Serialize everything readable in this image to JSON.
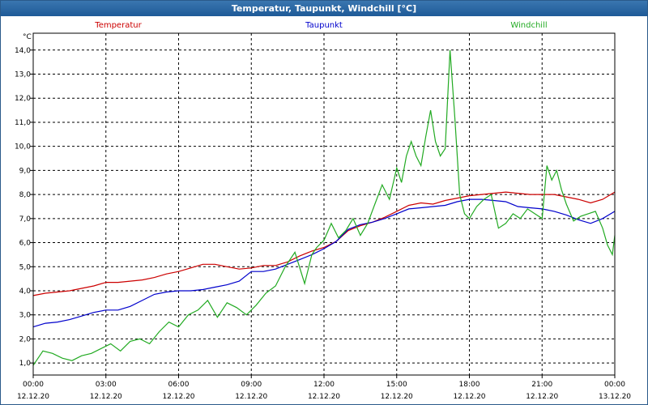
{
  "window": {
    "title": "Temperatur, Taupunkt, Windchill [°C]"
  },
  "colors": {
    "temperatur": "#cc0000",
    "taupunkt": "#0000cc",
    "windchill": "#22aa22",
    "grid": "#000000"
  },
  "chart_data": {
    "type": "line",
    "title": "Temperatur, Taupunkt, Windchill [°C]",
    "ylabel": "°C",
    "ylim": [
      0.5,
      14.7
    ],
    "yticks": [
      "1,0",
      "2,0",
      "3,0",
      "4,0",
      "5,0",
      "6,0",
      "7,0",
      "8,0",
      "9,0",
      "10,0",
      "11,0",
      "12,0",
      "13,0",
      "14,0"
    ],
    "ytick_values": [
      1,
      2,
      3,
      4,
      5,
      6,
      7,
      8,
      9,
      10,
      11,
      12,
      13,
      14
    ],
    "xlim": [
      0,
      24
    ],
    "xticks": [
      {
        "x": 0,
        "time": "00:00",
        "date": "12.12.20"
      },
      {
        "x": 3,
        "time": "03:00",
        "date": "12.12.20"
      },
      {
        "x": 6,
        "time": "06:00",
        "date": "12.12.20"
      },
      {
        "x": 9,
        "time": "09:00",
        "date": "12.12.20"
      },
      {
        "x": 12,
        "time": "12:00",
        "date": "12.12.20"
      },
      {
        "x": 15,
        "time": "15:00",
        "date": "12.12.20"
      },
      {
        "x": 18,
        "time": "18:00",
        "date": "12.12.20"
      },
      {
        "x": 21,
        "time": "21:00",
        "date": "12.12.20"
      },
      {
        "x": 24,
        "time": "00:00",
        "date": "13.12.20"
      }
    ],
    "grid": true,
    "legend_placement": "top",
    "series": [
      {
        "name": "Temperatur",
        "x": [
          0,
          0.5,
          1,
          1.5,
          2,
          2.5,
          3,
          3.5,
          4,
          4.5,
          5,
          5.5,
          6,
          6.5,
          7,
          7.5,
          8,
          8.5,
          9,
          9.5,
          10,
          10.5,
          11,
          11.5,
          12,
          12.5,
          13,
          13.5,
          14,
          14.5,
          15,
          15.5,
          16,
          16.5,
          17,
          17.5,
          18,
          18.5,
          19,
          19.5,
          20,
          20.5,
          21,
          21.5,
          22,
          22.5,
          23,
          23.5,
          24
        ],
        "values": [
          3.8,
          3.9,
          3.95,
          4.0,
          4.1,
          4.2,
          4.35,
          4.35,
          4.4,
          4.45,
          4.55,
          4.7,
          4.8,
          4.95,
          5.1,
          5.1,
          5.0,
          4.9,
          4.95,
          5.05,
          5.05,
          5.2,
          5.45,
          5.65,
          5.8,
          6.05,
          6.5,
          6.7,
          6.85,
          7.05,
          7.3,
          7.55,
          7.65,
          7.6,
          7.75,
          7.85,
          7.95,
          8.0,
          8.05,
          8.1,
          8.05,
          8.0,
          8.0,
          8.0,
          7.9,
          7.8,
          7.65,
          7.8,
          8.1
        ]
      },
      {
        "name": "Taupunkt",
        "x": [
          0,
          0.5,
          1,
          1.5,
          2,
          2.5,
          3,
          3.5,
          4,
          4.5,
          5,
          5.5,
          6,
          6.5,
          7,
          7.5,
          8,
          8.5,
          9,
          9.5,
          10,
          10.5,
          11,
          11.5,
          12,
          12.5,
          13,
          13.5,
          14,
          14.5,
          15,
          15.5,
          16,
          16.5,
          17,
          17.5,
          18,
          18.5,
          19,
          19.5,
          20,
          20.5,
          21,
          21.5,
          22,
          22.5,
          23,
          23.5,
          24
        ],
        "values": [
          2.5,
          2.65,
          2.7,
          2.8,
          2.95,
          3.1,
          3.2,
          3.2,
          3.35,
          3.6,
          3.85,
          3.95,
          4.0,
          4.0,
          4.05,
          4.15,
          4.25,
          4.4,
          4.8,
          4.8,
          4.9,
          5.1,
          5.3,
          5.5,
          5.75,
          6.05,
          6.55,
          6.75,
          6.85,
          7.0,
          7.2,
          7.4,
          7.45,
          7.5,
          7.55,
          7.7,
          7.8,
          7.8,
          7.75,
          7.7,
          7.5,
          7.45,
          7.4,
          7.3,
          7.15,
          6.95,
          6.8,
          7.0,
          7.3
        ]
      },
      {
        "name": "Windchill",
        "x": [
          0,
          0.4,
          0.8,
          1.2,
          1.6,
          2,
          2.4,
          2.8,
          3.2,
          3.6,
          4,
          4.4,
          4.8,
          5.2,
          5.6,
          6,
          6.4,
          6.8,
          7.2,
          7.6,
          8,
          8.4,
          8.8,
          9.2,
          9.6,
          10,
          10.4,
          10.8,
          11.2,
          11.5,
          11.7,
          12,
          12.3,
          12.6,
          12.9,
          13.2,
          13.5,
          13.8,
          14.1,
          14.4,
          14.7,
          15,
          15.2,
          15.4,
          15.6,
          15.8,
          16,
          16.2,
          16.4,
          16.6,
          16.8,
          17,
          17.2,
          17.4,
          17.6,
          17.8,
          18,
          18.3,
          18.6,
          18.9,
          19.2,
          19.5,
          19.8,
          20.1,
          20.4,
          20.7,
          21,
          21.2,
          21.4,
          21.6,
          21.8,
          22,
          22.3,
          22.6,
          22.9,
          23.2,
          23.5,
          23.7,
          23.9,
          24
        ],
        "values": [
          0.9,
          1.5,
          1.4,
          1.2,
          1.1,
          1.3,
          1.4,
          1.6,
          1.8,
          1.5,
          1.9,
          2.0,
          1.8,
          2.3,
          2.7,
          2.5,
          3.0,
          3.2,
          3.6,
          2.9,
          3.5,
          3.3,
          3.0,
          3.4,
          3.9,
          4.2,
          5.0,
          5.6,
          4.3,
          5.5,
          5.8,
          6.1,
          6.8,
          6.2,
          6.5,
          7.0,
          6.3,
          6.8,
          7.6,
          8.4,
          7.8,
          9.1,
          8.5,
          9.6,
          10.2,
          9.6,
          9.2,
          10.4,
          11.5,
          10.2,
          9.6,
          9.9,
          14.0,
          11.2,
          8.0,
          7.2,
          7.0,
          7.5,
          7.8,
          8.0,
          6.6,
          6.8,
          7.2,
          7.0,
          7.4,
          7.2,
          7.0,
          9.2,
          8.6,
          9.0,
          8.2,
          7.6,
          6.9,
          7.1,
          7.2,
          7.3,
          6.6,
          5.9,
          5.5,
          6.3
        ]
      }
    ]
  }
}
